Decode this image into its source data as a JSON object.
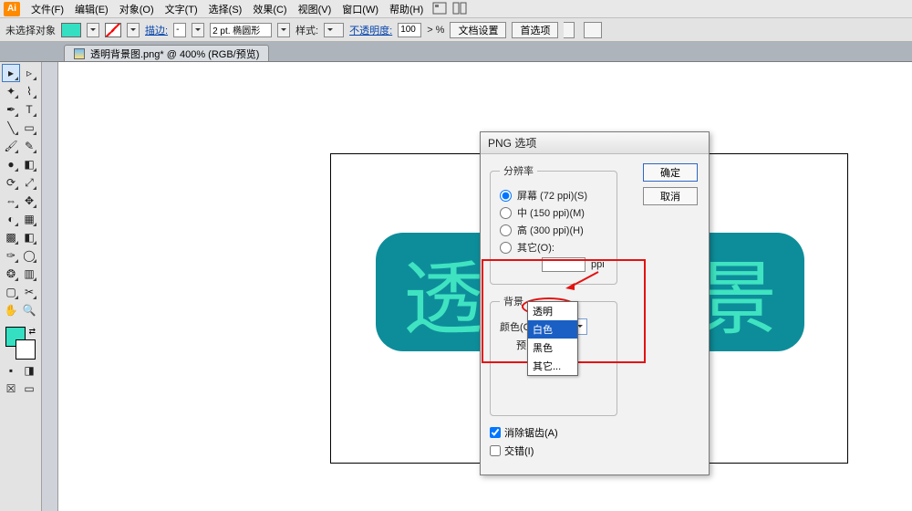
{
  "menu": {
    "items": [
      "文件(F)",
      "编辑(E)",
      "对象(O)",
      "文字(T)",
      "选择(S)",
      "效果(C)",
      "视图(V)",
      "窗口(W)",
      "帮助(H)"
    ],
    "logo": "Ai"
  },
  "optbar": {
    "sel_label": "未选择对象",
    "stroke_label": "描边:",
    "dash": "-",
    "stroke_val": "2 pt. 椭圆形",
    "style_label": "样式:",
    "opacity_label": "不透明度:",
    "opacity_val": "100",
    "pct": "> %",
    "docset": "文档设置",
    "prefs": "首选项"
  },
  "doctab": {
    "title": "透明背景图.png* @ 400% (RGB/预览)"
  },
  "dialog": {
    "title": "PNG 选项",
    "res_legend": "分辨率",
    "r1": "屏幕 (72 ppi)(S)",
    "r2": "中 (150 ppi)(M)",
    "r3": "高 (300 ppi)(H)",
    "r4": "其它(O):",
    "ppi_unit": "ppi",
    "bg_legend": "背景",
    "color_label": "颜色(C):",
    "color_value": "白色",
    "preview_label": "预览",
    "ok": "确定",
    "cancel": "取消",
    "anti": "消除锯齿(A)",
    "interlace": "交错(I)"
  },
  "dropdown": {
    "sel_text": "透明",
    "o1": "白色",
    "o2": "黑色",
    "o3": "其它..."
  },
  "canvas": {
    "char_left": "透",
    "char_right": "景"
  }
}
